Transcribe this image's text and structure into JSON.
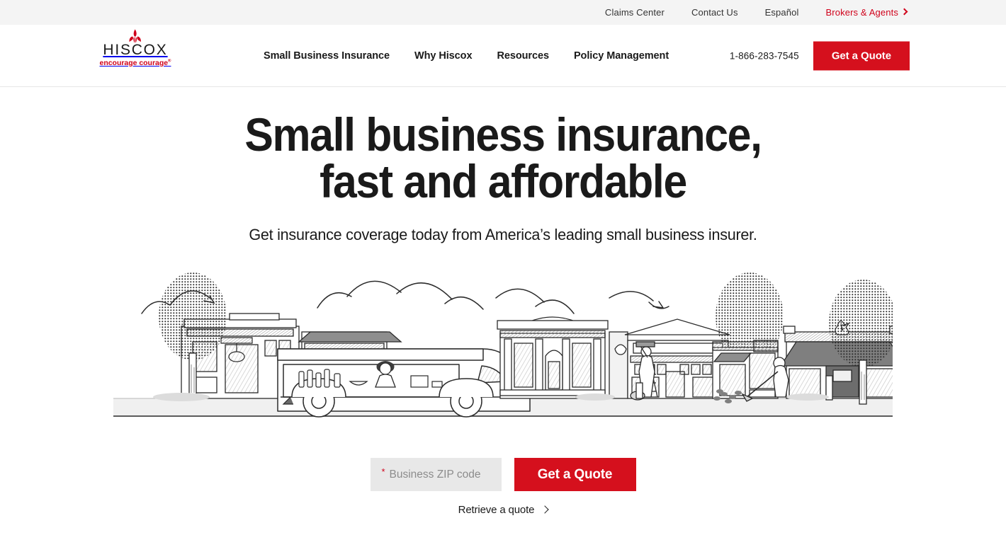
{
  "utility_bar": {
    "links": [
      {
        "label": "Claims Center",
        "name": "claims-center"
      },
      {
        "label": "Contact Us",
        "name": "contact-us"
      },
      {
        "label": "Español",
        "name": "espanol"
      },
      {
        "label": "Brokers & Agents",
        "name": "brokers-agents",
        "accent": true
      }
    ]
  },
  "header": {
    "logo": {
      "wordmark": "HISCOX",
      "tagline": "encourage courage",
      "registered": "®",
      "mark": "fleur-de-lis-icon",
      "color": "#d0021b"
    },
    "nav": [
      {
        "label": "Small Business Insurance"
      },
      {
        "label": "Why Hiscox"
      },
      {
        "label": "Resources"
      },
      {
        "label": "Policy Management"
      }
    ],
    "phone": "1-866-283-7545",
    "cta_label": "Get a Quote"
  },
  "hero": {
    "title_line1": "Small business insurance,",
    "title_line2": "fast and affordable",
    "subtitle": "Get insurance coverage today from America’s leading small business insurer.",
    "illustration_name": "main-street-storefronts-illustration"
  },
  "quote_form": {
    "required_marker": "*",
    "zip_placeholder": "Business ZIP code",
    "zip_value": "",
    "submit_label": "Get a Quote",
    "retrieve_label": "Retrieve a quote"
  },
  "theme": {
    "brand_red": "#d0021b",
    "button_red": "#d5101d",
    "utility_bg": "#f4f4f4",
    "input_bg": "#e8e8e8",
    "text": "#1a1a1a"
  }
}
